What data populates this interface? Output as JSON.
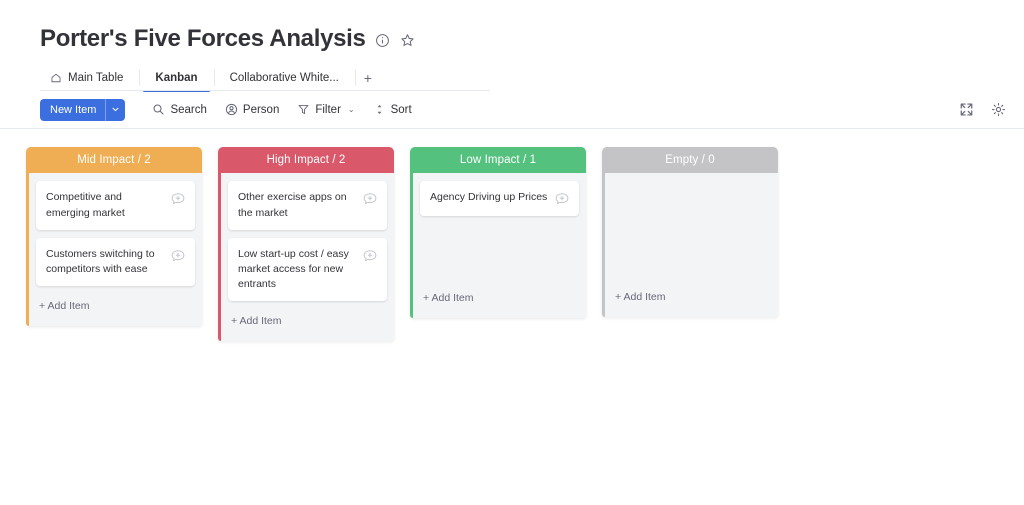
{
  "header": {
    "title": "Porter's Five Forces Analysis",
    "info_icon": "info-circle-icon",
    "favorite_icon": "star-icon"
  },
  "tabs": [
    {
      "label": "Main Table",
      "icon": "home-icon",
      "active": false
    },
    {
      "label": "Kanban",
      "icon": "",
      "active": true
    },
    {
      "label": "Collaborative White...",
      "icon": "",
      "active": false
    }
  ],
  "tab_add_label": "+",
  "toolbar": {
    "new_item_label": "New Item",
    "new_item_caret": "⌄",
    "new_item_color": "#3b6fe0",
    "search_label": "Search",
    "person_label": "Person",
    "filter_label": "Filter",
    "sort_label": "Sort",
    "filter_caret": "⌄",
    "expand_icon": "expand-collapse-icon",
    "settings_icon": "gear-icon"
  },
  "kanban": {
    "add_item_label": "+ Add Item",
    "columns": [
      {
        "title": "Mid Impact / 2",
        "color": "#efae53",
        "count": 2,
        "cards": [
          {
            "text": "Competitive and emerging market"
          },
          {
            "text": "Customers switching to competitors with ease"
          }
        ]
      },
      {
        "title": "High Impact / 2",
        "color": "#d9596a",
        "count": 2,
        "cards": [
          {
            "text": "Other exercise apps on the market"
          },
          {
            "text": "Low start-up cost / easy market access for new entrants"
          }
        ]
      },
      {
        "title": "Low Impact / 1",
        "color": "#55c17f",
        "count": 1,
        "cards": [
          {
            "text": "Agency Driving up Prices"
          }
        ]
      },
      {
        "title": "Empty / 0",
        "color": "#c4c4c6",
        "count": 0,
        "cards": []
      }
    ]
  }
}
